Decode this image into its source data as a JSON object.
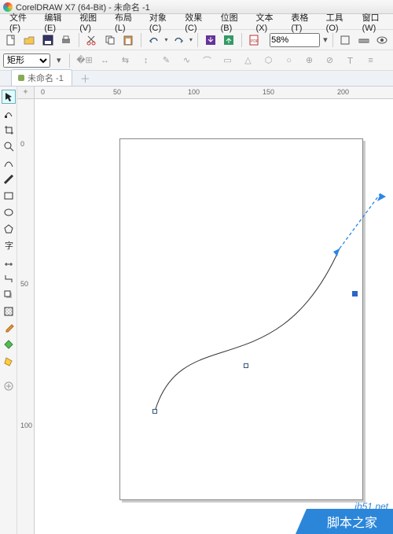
{
  "title": "CorelDRAW X7 (64-Bit) - 未命名 -1",
  "menu": [
    "文件(F)",
    "编辑(E)",
    "视图(V)",
    "布局(L)",
    "对象(C)",
    "效果(C)",
    "位图(B)",
    "文本(X)",
    "表格(T)",
    "工具(O)",
    "窗口(W)"
  ],
  "zoom": "58%",
  "shape_select": "矩形",
  "tab": {
    "label": "未命名 -1"
  },
  "ruler_h": [
    "0",
    "50",
    "100",
    "150",
    "200"
  ],
  "ruler_v": [
    "0",
    "50",
    "100"
  ],
  "watermark": {
    "url": "jb51.net",
    "text": "脚本之家"
  }
}
